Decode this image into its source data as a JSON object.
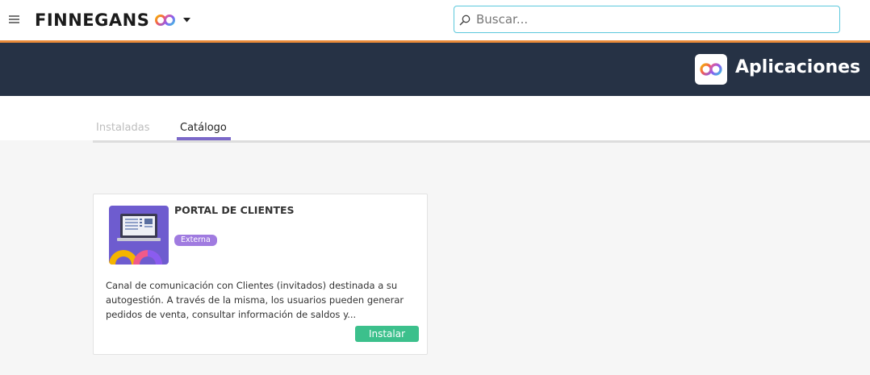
{
  "topbar": {
    "brand": "FINNEGANS",
    "search_placeholder": "Buscar...",
    "search_value": ""
  },
  "header": {
    "title": "Aplicaciones"
  },
  "tabs": [
    {
      "label": "Instaladas",
      "active": false
    },
    {
      "label": "Catálogo",
      "active": true
    }
  ],
  "apps": [
    {
      "title": "PORTAL DE CLIENTES",
      "badge": "Externa",
      "description": "Canal de comunicación con Clientes (invitados) destinada a su autogestión. A través de la misma, los usuarios pueden generar pedidos de venta, consultar información de saldos y...",
      "action_label": "Instalar",
      "icon": "laptop-portal-icon"
    }
  ],
  "colors": {
    "accent_orange": "#e98b3a",
    "header_bg": "#263245",
    "tab_active": "#7b68c8",
    "search_border": "#5cc8dc",
    "install_button": "#3cc08c",
    "badge": "#a07be0"
  }
}
